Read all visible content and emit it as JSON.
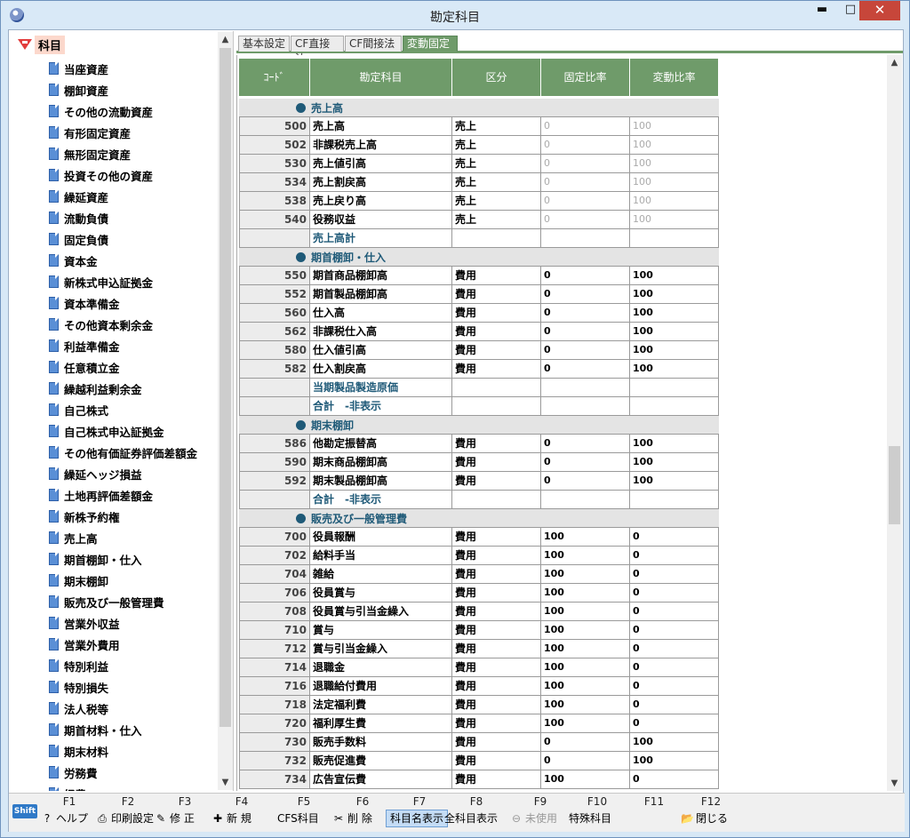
{
  "window": {
    "title": "勘定科目",
    "minimize": "▬",
    "maximize": "□",
    "close": "✕"
  },
  "tree": {
    "root": "科目",
    "items": [
      "当座資産",
      "棚卸資産",
      "その他の流動資産",
      "有形固定資産",
      "無形固定資産",
      "投資その他の資産",
      "繰延資産",
      "流動負債",
      "固定負債",
      "資本金",
      "新株式申込証拠金",
      "資本準備金",
      "その他資本剰余金",
      "利益準備金",
      "任意積立金",
      "繰越利益剰余金",
      "自己株式",
      "自己株式申込証拠金",
      "その他有価証券評価差額金",
      "繰延ヘッジ損益",
      "土地再評価差額金",
      "新株予約権",
      "売上高",
      "期首棚卸・仕入",
      "期末棚卸",
      "販売及び一般管理費",
      "営業外収益",
      "営業外費用",
      "特別利益",
      "特別損失",
      "法人税等",
      "期首材料・仕入",
      "期末材料",
      "労務費",
      "経費"
    ]
  },
  "tabs": [
    "基本設定",
    "CF直接法",
    "CF間接法",
    "変動固定"
  ],
  "grid": {
    "headers": [
      "ｺｰﾄﾞ",
      "勘定科目",
      "区分",
      "固定比率",
      "変動比率"
    ],
    "rows": [
      {
        "type": "section",
        "name": "売上高"
      },
      {
        "type": "row",
        "code": "500",
        "name": "売上高",
        "kubun": "売上",
        "fixed": "0",
        "variable": "100",
        "dim": true
      },
      {
        "type": "row",
        "code": "502",
        "name": "非課税売上高",
        "kubun": "売上",
        "fixed": "0",
        "variable": "100",
        "dim": true
      },
      {
        "type": "row",
        "code": "530",
        "name": "売上値引高",
        "kubun": "売上",
        "fixed": "0",
        "variable": "100",
        "dim": true
      },
      {
        "type": "row",
        "code": "534",
        "name": "売上割戻高",
        "kubun": "売上",
        "fixed": "0",
        "variable": "100",
        "dim": true
      },
      {
        "type": "row",
        "code": "538",
        "name": "売上戻り高",
        "kubun": "売上",
        "fixed": "0",
        "variable": "100",
        "dim": true
      },
      {
        "type": "row",
        "code": "540",
        "name": "役務収益",
        "kubun": "売上",
        "fixed": "0",
        "variable": "100",
        "dim": true
      },
      {
        "type": "subtotal",
        "code": "",
        "name": "売上高計",
        "kubun": "",
        "fixed": "",
        "variable": ""
      },
      {
        "type": "section",
        "name": "期首棚卸・仕入"
      },
      {
        "type": "row",
        "code": "550",
        "name": "期首商品棚卸高",
        "kubun": "費用",
        "fixed": "0",
        "variable": "100"
      },
      {
        "type": "row",
        "code": "552",
        "name": "期首製品棚卸高",
        "kubun": "費用",
        "fixed": "0",
        "variable": "100"
      },
      {
        "type": "row",
        "code": "560",
        "name": "仕入高",
        "kubun": "費用",
        "fixed": "0",
        "variable": "100"
      },
      {
        "type": "row",
        "code": "562",
        "name": "非課税仕入高",
        "kubun": "費用",
        "fixed": "0",
        "variable": "100"
      },
      {
        "type": "row",
        "code": "580",
        "name": "仕入値引高",
        "kubun": "費用",
        "fixed": "0",
        "variable": "100"
      },
      {
        "type": "row",
        "code": "582",
        "name": "仕入割戻高",
        "kubun": "費用",
        "fixed": "0",
        "variable": "100"
      },
      {
        "type": "subtotal",
        "code": "",
        "name": "当期製品製造原価",
        "kubun": "",
        "fixed": "",
        "variable": ""
      },
      {
        "type": "subtotal",
        "code": "",
        "name": "合計　-非表示",
        "kubun": "",
        "fixed": "",
        "variable": ""
      },
      {
        "type": "section",
        "name": "期末棚卸"
      },
      {
        "type": "row",
        "code": "586",
        "name": "他勘定振替高",
        "kubun": "費用",
        "fixed": "0",
        "variable": "100"
      },
      {
        "type": "row",
        "code": "590",
        "name": "期末商品棚卸高",
        "kubun": "費用",
        "fixed": "0",
        "variable": "100"
      },
      {
        "type": "row",
        "code": "592",
        "name": "期末製品棚卸高",
        "kubun": "費用",
        "fixed": "0",
        "variable": "100"
      },
      {
        "type": "subtotal",
        "code": "",
        "name": "合計　-非表示",
        "kubun": "",
        "fixed": "",
        "variable": ""
      },
      {
        "type": "section",
        "name": "販売及び一般管理費"
      },
      {
        "type": "row",
        "code": "700",
        "name": "役員報酬",
        "kubun": "費用",
        "fixed": "100",
        "variable": "0"
      },
      {
        "type": "row",
        "code": "702",
        "name": "給料手当",
        "kubun": "費用",
        "fixed": "100",
        "variable": "0"
      },
      {
        "type": "row",
        "code": "704",
        "name": "雑給",
        "kubun": "費用",
        "fixed": "100",
        "variable": "0"
      },
      {
        "type": "row",
        "code": "706",
        "name": "役員賞与",
        "kubun": "費用",
        "fixed": "100",
        "variable": "0"
      },
      {
        "type": "row",
        "code": "708",
        "name": "役員賞与引当金繰入",
        "kubun": "費用",
        "fixed": "100",
        "variable": "0"
      },
      {
        "type": "row",
        "code": "710",
        "name": "賞与",
        "kubun": "費用",
        "fixed": "100",
        "variable": "0"
      },
      {
        "type": "row",
        "code": "712",
        "name": "賞与引当金繰入",
        "kubun": "費用",
        "fixed": "100",
        "variable": "0"
      },
      {
        "type": "row",
        "code": "714",
        "name": "退職金",
        "kubun": "費用",
        "fixed": "100",
        "variable": "0"
      },
      {
        "type": "row",
        "code": "716",
        "name": "退職給付費用",
        "kubun": "費用",
        "fixed": "100",
        "variable": "0"
      },
      {
        "type": "row",
        "code": "718",
        "name": "法定福利費",
        "kubun": "費用",
        "fixed": "100",
        "variable": "0"
      },
      {
        "type": "row",
        "code": "720",
        "name": "福利厚生費",
        "kubun": "費用",
        "fixed": "100",
        "variable": "0"
      },
      {
        "type": "row",
        "code": "730",
        "name": "販売手数料",
        "kubun": "費用",
        "fixed": "0",
        "variable": "100"
      },
      {
        "type": "row",
        "code": "732",
        "name": "販売促進費",
        "kubun": "費用",
        "fixed": "0",
        "variable": "100"
      },
      {
        "type": "row",
        "code": "734",
        "name": "広告宣伝費",
        "kubun": "費用",
        "fixed": "100",
        "variable": "0"
      }
    ]
  },
  "fkeys": {
    "shift": "Shift",
    "labels": [
      "F1",
      "F2",
      "F3",
      "F4",
      "F5",
      "F6",
      "F7",
      "F8",
      "F9",
      "F10",
      "F11",
      "F12"
    ],
    "buttons": [
      {
        "key": "F1",
        "label": "ヘルプ",
        "icon": "help-icon",
        "glyph": "?"
      },
      {
        "key": "F2",
        "label": "印刷設定",
        "icon": "printer-icon",
        "glyph": "⎙"
      },
      {
        "key": "F3",
        "label": "修 正",
        "icon": "edit-icon",
        "glyph": "✎"
      },
      {
        "key": "F4",
        "label": "新 規",
        "icon": "new-icon",
        "glyph": "✚"
      },
      {
        "key": "F5",
        "label": "CFS科目",
        "icon": "",
        "glyph": ""
      },
      {
        "key": "F6",
        "label": "削 除",
        "icon": "scissors-icon",
        "glyph": "✂"
      },
      {
        "key": "F7",
        "label": "科目名表示",
        "icon": "",
        "glyph": "",
        "selected": true
      },
      {
        "key": "F8",
        "label": "全科目表示",
        "icon": "",
        "glyph": ""
      },
      {
        "key": "F9",
        "label": "未使用",
        "icon": "disabled-icon",
        "glyph": "⊖",
        "disabled": true
      },
      {
        "key": "F10",
        "label": "特殊科目",
        "icon": "",
        "glyph": ""
      },
      {
        "key": "F12",
        "label": "閉じる",
        "icon": "folder-icon",
        "glyph": "📂"
      }
    ]
  }
}
